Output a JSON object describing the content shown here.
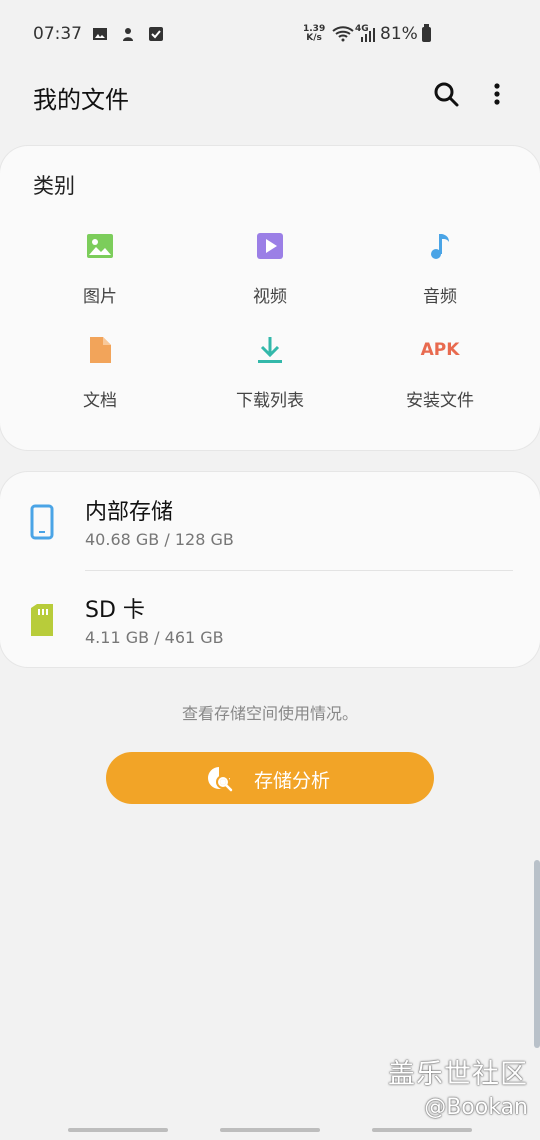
{
  "status_bar": {
    "time": "07:37",
    "net_speed_value": "1.39",
    "net_speed_unit": "K/s",
    "network": "4G",
    "battery": "81%"
  },
  "app_bar": {
    "title": "我的文件"
  },
  "categories": {
    "title": "类别",
    "items": [
      {
        "label": "图片",
        "icon": "image-icon",
        "color": "#7ccd5b"
      },
      {
        "label": "视频",
        "icon": "video-icon",
        "color": "#9b7fe6"
      },
      {
        "label": "音频",
        "icon": "music-icon",
        "color": "#4aa4e6"
      },
      {
        "label": "文档",
        "icon": "document-icon",
        "color": "#f2a45a"
      },
      {
        "label": "下载列表",
        "icon": "download-icon",
        "color": "#33b8aa"
      },
      {
        "label": "安装文件",
        "icon": "apk-icon",
        "icon_text": "APK",
        "color": "#e86a4f"
      }
    ]
  },
  "storage": [
    {
      "name": "内部存储",
      "size": "40.68 GB / 128 GB",
      "icon": "phone-icon",
      "color": "#4aa4e6"
    },
    {
      "name": "SD 卡",
      "size": "4.11 GB / 461 GB",
      "icon": "sd-card-icon",
      "color": "#b8cc3a"
    }
  ],
  "hint": "查看存储空间使用情况。",
  "analyze_button": {
    "label": "存储分析",
    "color": "#f2a427"
  },
  "watermark": {
    "line1": "盖乐世社区",
    "line2": "@Bookan"
  }
}
